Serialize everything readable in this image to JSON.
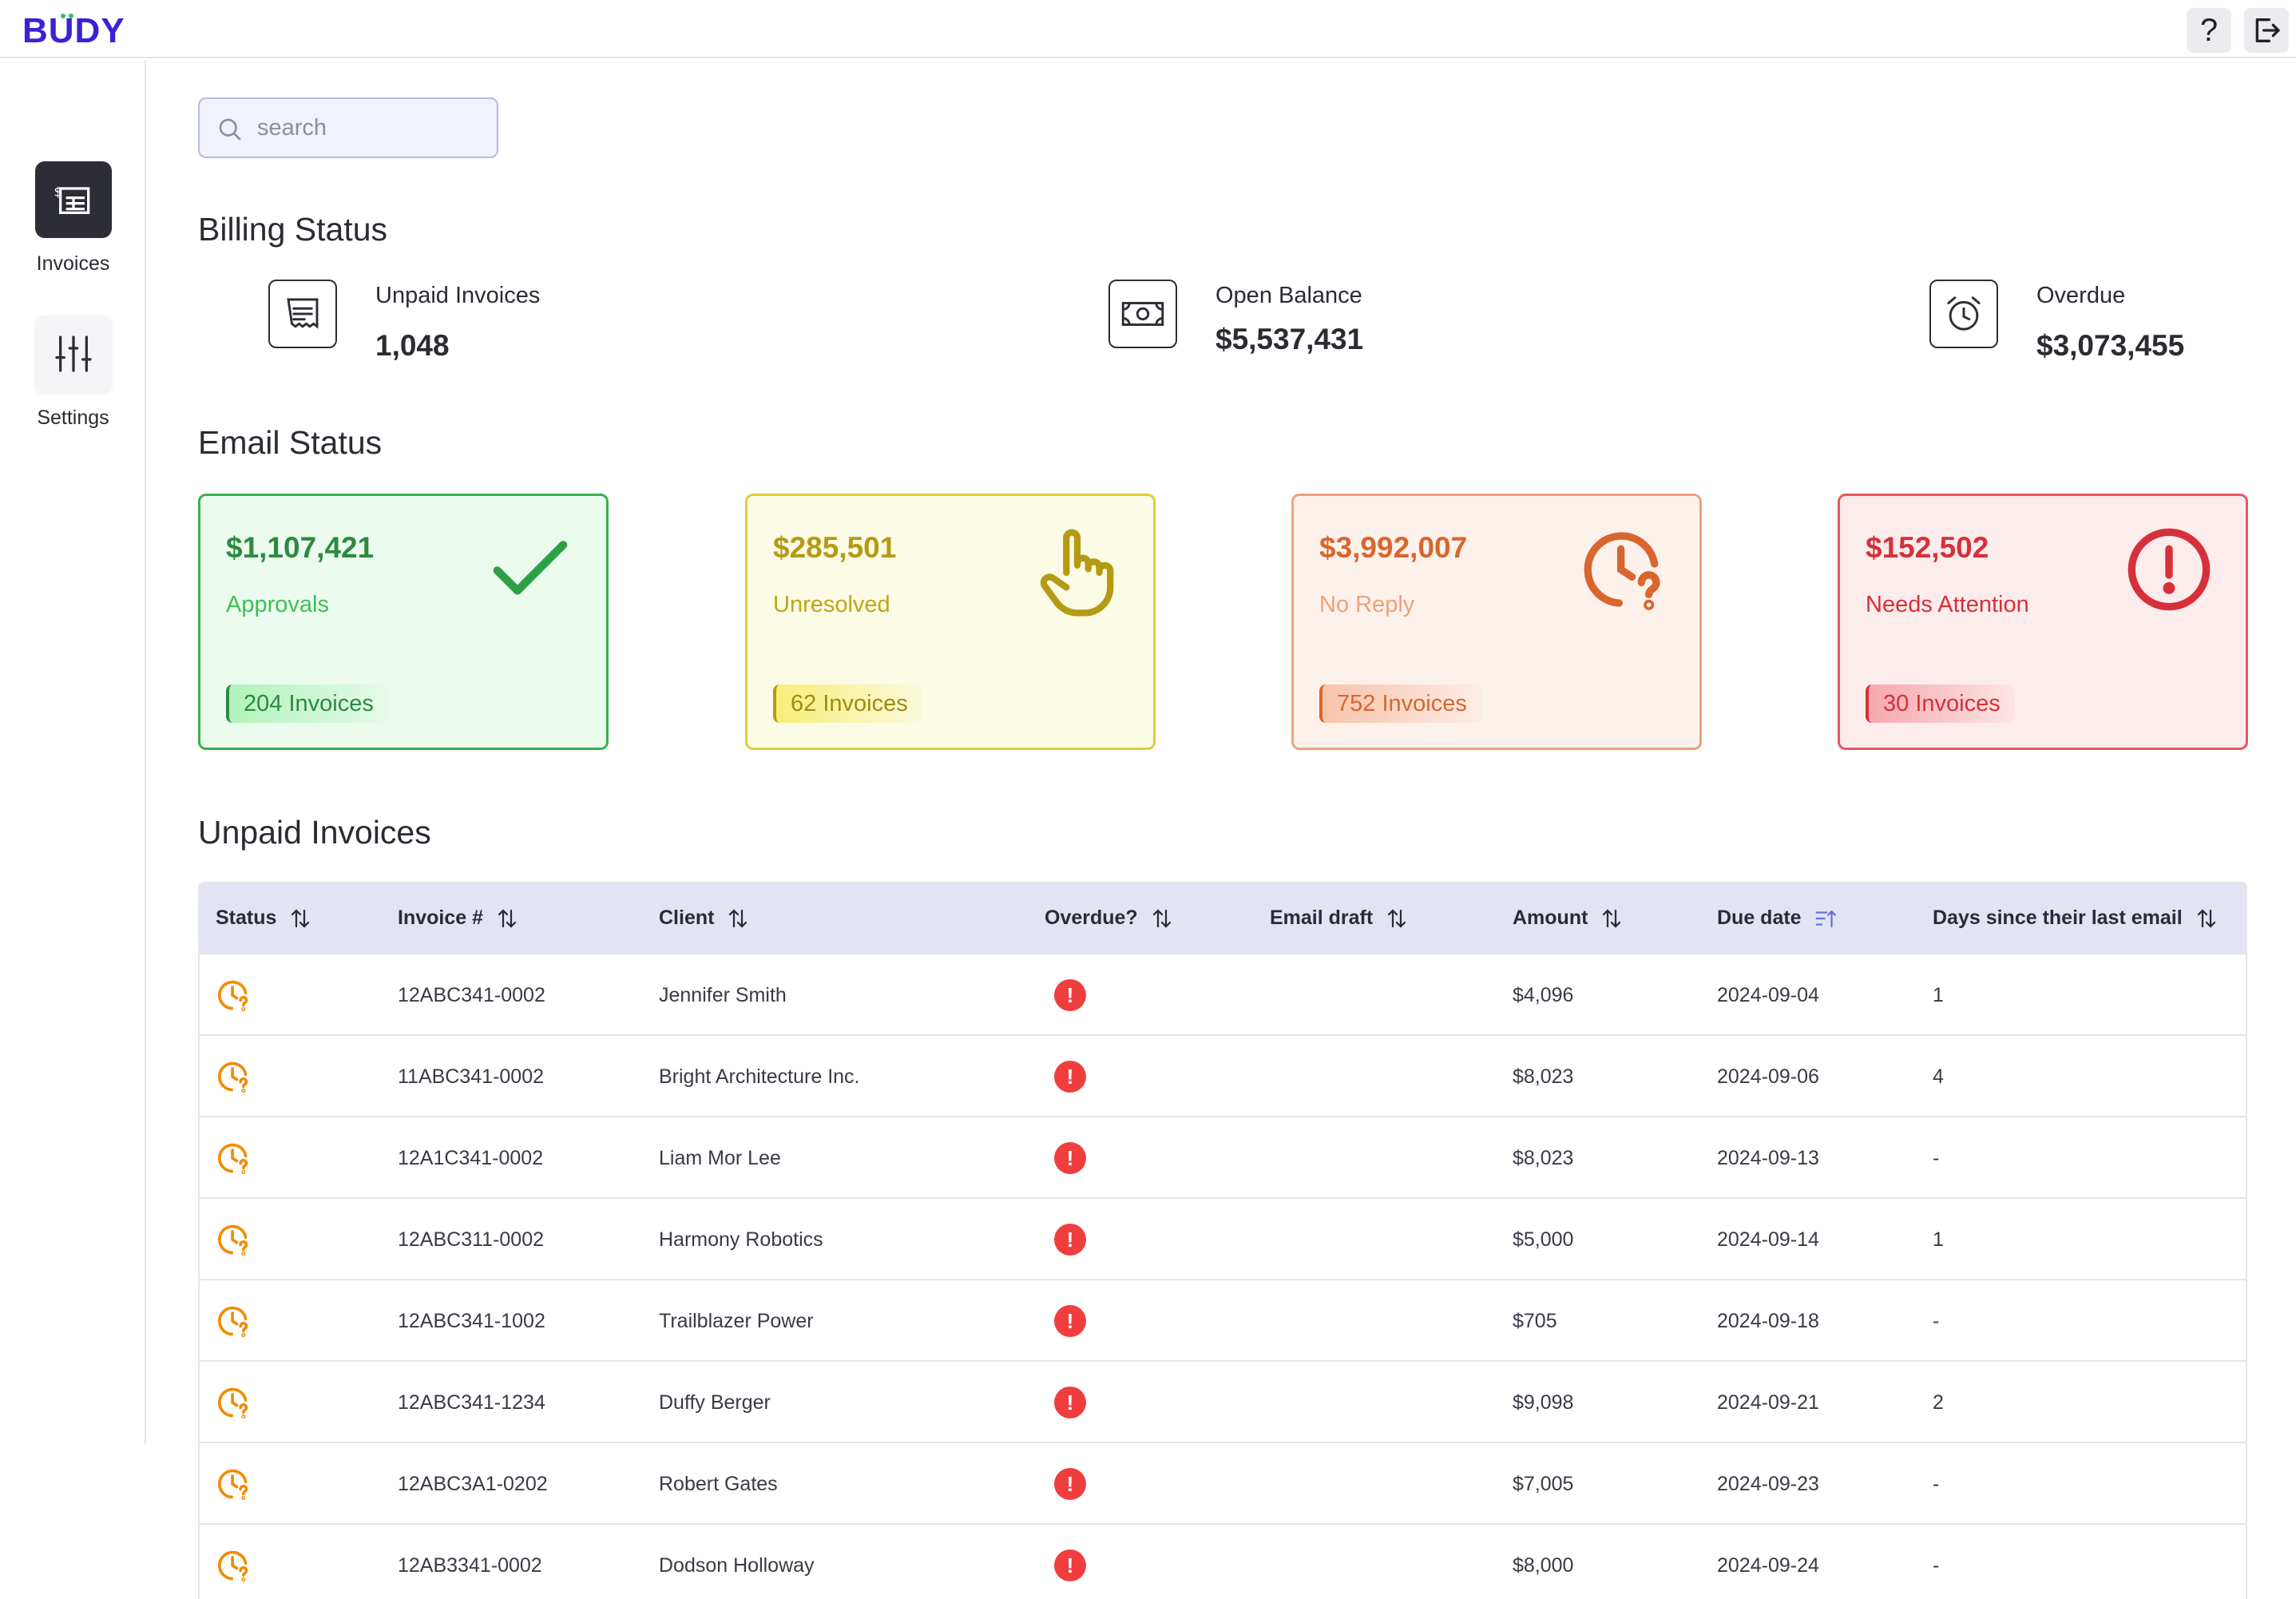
{
  "app": {
    "logo_text": "BUDY",
    "brand_color": "#3a22d6",
    "help_label": "?"
  },
  "sidebar": {
    "items": [
      {
        "label": "Invoices",
        "icon": "invoice-icon",
        "active": true
      },
      {
        "label": "Settings",
        "icon": "sliders-icon",
        "active": false
      }
    ]
  },
  "search": {
    "placeholder": "search"
  },
  "billing": {
    "title": "Billing Status",
    "items": [
      {
        "label": "Unpaid Invoices",
        "value": "1,048",
        "icon": "receipt-icon"
      },
      {
        "label": "Open Balance",
        "value": "$5,537,431",
        "icon": "cash-icon"
      },
      {
        "label": "Overdue",
        "value": "$3,073,455",
        "icon": "alarm-clock-icon"
      }
    ]
  },
  "email": {
    "title": "Email Status",
    "cards": [
      {
        "amount": "$1,107,421",
        "label": "Approvals",
        "pill": "204 Invoices",
        "icon": "check-icon",
        "color": "#37b24d"
      },
      {
        "amount": "$285,501",
        "label": "Unresolved",
        "pill": "62 Invoices",
        "icon": "pointing-hand-icon",
        "color": "#b59a14"
      },
      {
        "amount": "$3,992,007",
        "label": "No Reply",
        "pill": "752 Invoices",
        "icon": "clock-question-icon",
        "color": "#d9662e"
      },
      {
        "amount": "$152,502",
        "label": "Needs Attention",
        "pill": "30 Invoices",
        "icon": "alert-circle-icon",
        "color": "#d6303a"
      }
    ]
  },
  "table": {
    "title": "Unpaid Invoices",
    "headers": [
      "Status",
      "Invoice #",
      "Client",
      "Overdue?",
      "Email draft",
      "Amount",
      "Due date",
      "Days since their last email"
    ],
    "overdue_mark": "!",
    "rows": [
      {
        "invoice": "12ABC341-0002",
        "client": "Jennifer Smith",
        "draft": "",
        "amount": "$4,096",
        "due": "2024-09-04",
        "days": "1"
      },
      {
        "invoice": "11ABC341-0002",
        "client": "Bright Architecture Inc.",
        "draft": "",
        "amount": "$8,023",
        "due": "2024-09-06",
        "days": "4"
      },
      {
        "invoice": "12A1C341-0002",
        "client": "Liam Mor Lee",
        "draft": "",
        "amount": "$8,023",
        "due": "2024-09-13",
        "days": "-"
      },
      {
        "invoice": "12ABC311-0002",
        "client": "Harmony Robotics",
        "draft": "",
        "amount": "$5,000",
        "due": "2024-09-14",
        "days": "1"
      },
      {
        "invoice": "12ABC341-1002",
        "client": "Trailblazer Power",
        "draft": "",
        "amount": "$705",
        "due": "2024-09-18",
        "days": "-"
      },
      {
        "invoice": "12ABC341-1234",
        "client": "Duffy Berger",
        "draft": "",
        "amount": "$9,098",
        "due": "2024-09-21",
        "days": "2"
      },
      {
        "invoice": "12ABC3A1-0202",
        "client": "Robert Gates",
        "draft": "",
        "amount": "$7,005",
        "due": "2024-09-23",
        "days": "-"
      },
      {
        "invoice": "12AB3341-0002",
        "client": "Dodson Holloway",
        "draft": "",
        "amount": "$8,000",
        "due": "2024-09-24",
        "days": "-"
      }
    ]
  }
}
